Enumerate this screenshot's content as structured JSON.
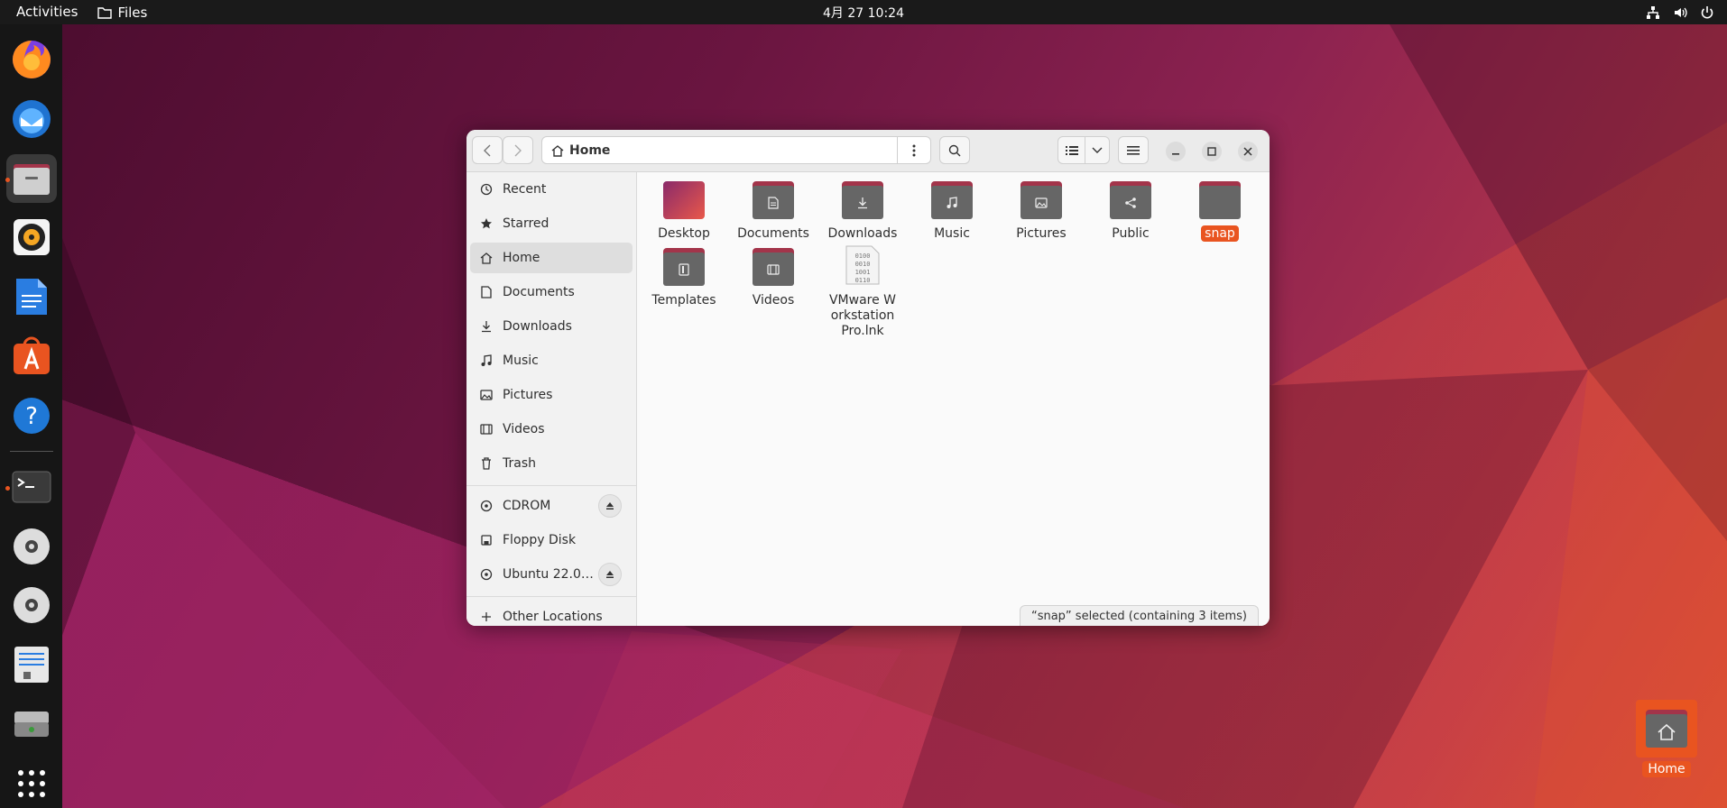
{
  "colors": {
    "accent": "#e95420",
    "folder_tab": "#a3344a",
    "folder_body": "#666666"
  },
  "topbar": {
    "activities": "Activities",
    "app_name": "Files",
    "clock": "4月 27  10:24",
    "tray_icons": [
      "network-icon",
      "volume-icon",
      "power-icon"
    ]
  },
  "dock": {
    "items": [
      "firefox-icon",
      "thunderbird-icon",
      "files-icon",
      "rhythmbox-icon",
      "writer-icon",
      "app-center-icon",
      "help-icon",
      "terminal-icon",
      "disc-icon",
      "disc-icon",
      "text-editor-icon",
      "drive-icon",
      "app-grid-icon"
    ]
  },
  "window": {
    "path": "Home",
    "sidebar": {
      "places": [
        "Recent",
        "Starred",
        "Home",
        "Documents",
        "Downloads",
        "Music",
        "Pictures",
        "Videos",
        "Trash"
      ],
      "devices": [
        "CDROM",
        "Floppy Disk",
        "Ubuntu 22.0…"
      ],
      "other": "Other Locations",
      "selected": "Home"
    },
    "files": [
      {
        "name": "Desktop",
        "icon": "desktop-folder-icon"
      },
      {
        "name": "Documents",
        "icon": "documents-folder-icon"
      },
      {
        "name": "Downloads",
        "icon": "downloads-folder-icon"
      },
      {
        "name": "Music",
        "icon": "music-folder-icon"
      },
      {
        "name": "Pictures",
        "icon": "pictures-folder-icon"
      },
      {
        "name": "Public",
        "icon": "public-folder-icon"
      },
      {
        "name": "snap",
        "icon": "folder-icon",
        "selected": true
      },
      {
        "name": "Templates",
        "icon": "templates-folder-icon"
      },
      {
        "name": "Videos",
        "icon": "videos-folder-icon"
      },
      {
        "name": "VMware Workstation Pro.lnk",
        "icon": "binary-file-icon"
      }
    ],
    "status": "“snap” selected  (containing 3 items)"
  },
  "desktop": {
    "home_label": "Home"
  }
}
